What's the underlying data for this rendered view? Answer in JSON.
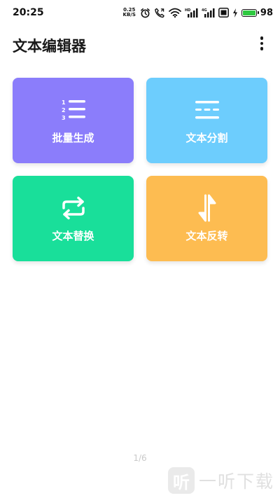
{
  "status_bar": {
    "time": "20:25",
    "net_speed_value": "0.25",
    "net_speed_unit": "KB/S",
    "signal1_label": "HD",
    "signal2_label": "4G",
    "battery": "98",
    "battery_level": 0.98,
    "battery_color": "#2ec940",
    "icons": [
      "alarm-icon",
      "call-icon",
      "wifi-icon",
      "signal-icon",
      "signal-icon",
      "sim-icon",
      "charging-icon",
      "battery-icon"
    ]
  },
  "app_bar": {
    "title": "文本编辑器",
    "menu_icon": "more-vert-icon"
  },
  "cards": [
    {
      "label": "批量生成",
      "icon": "numbered-list-icon",
      "color": "#8b7dfb",
      "icon_numbers": [
        "1",
        "2",
        "3"
      ]
    },
    {
      "label": "文本分割",
      "icon": "split-icon",
      "color": "#6dcdfd"
    },
    {
      "label": "文本替换",
      "icon": "swap-icon",
      "color": "#19df9a"
    },
    {
      "label": "文本反转",
      "icon": "reverse-icon",
      "color": "#fdbc51"
    }
  ],
  "pager": "1/6",
  "watermark": {
    "logo_text": "听",
    "text": "一听下载"
  }
}
